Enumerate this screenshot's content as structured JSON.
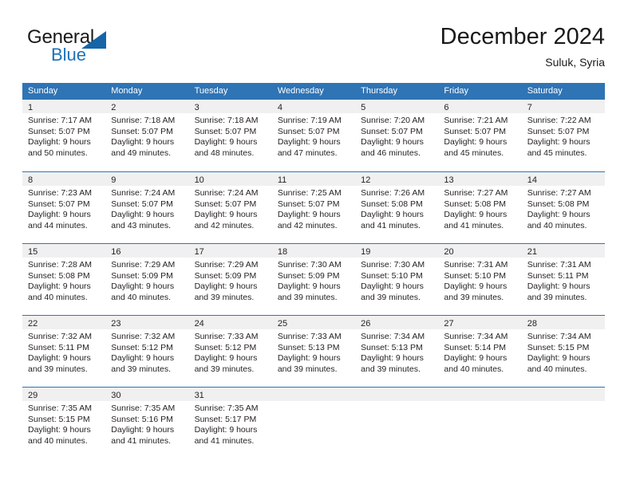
{
  "brand": {
    "name_top": "General",
    "name_bottom": "Blue",
    "accent_color": "#1d71b8",
    "triangle_color": "#1565a8"
  },
  "header": {
    "title": "December 2024",
    "subtitle": "Suluk, Syria"
  },
  "theme": {
    "header_blue": "#2f74b5",
    "day_band_gray": "#f0f0f0",
    "text_color": "#231f20"
  },
  "weekdays": [
    "Sunday",
    "Monday",
    "Tuesday",
    "Wednesday",
    "Thursday",
    "Friday",
    "Saturday"
  ],
  "weeks": [
    [
      {
        "day": "1",
        "lines": [
          "Sunrise: 7:17 AM",
          "Sunset: 5:07 PM",
          "Daylight: 9 hours",
          "and 50 minutes."
        ]
      },
      {
        "day": "2",
        "lines": [
          "Sunrise: 7:18 AM",
          "Sunset: 5:07 PM",
          "Daylight: 9 hours",
          "and 49 minutes."
        ]
      },
      {
        "day": "3",
        "lines": [
          "Sunrise: 7:18 AM",
          "Sunset: 5:07 PM",
          "Daylight: 9 hours",
          "and 48 minutes."
        ]
      },
      {
        "day": "4",
        "lines": [
          "Sunrise: 7:19 AM",
          "Sunset: 5:07 PM",
          "Daylight: 9 hours",
          "and 47 minutes."
        ]
      },
      {
        "day": "5",
        "lines": [
          "Sunrise: 7:20 AM",
          "Sunset: 5:07 PM",
          "Daylight: 9 hours",
          "and 46 minutes."
        ]
      },
      {
        "day": "6",
        "lines": [
          "Sunrise: 7:21 AM",
          "Sunset: 5:07 PM",
          "Daylight: 9 hours",
          "and 45 minutes."
        ]
      },
      {
        "day": "7",
        "lines": [
          "Sunrise: 7:22 AM",
          "Sunset: 5:07 PM",
          "Daylight: 9 hours",
          "and 45 minutes."
        ]
      }
    ],
    [
      {
        "day": "8",
        "lines": [
          "Sunrise: 7:23 AM",
          "Sunset: 5:07 PM",
          "Daylight: 9 hours",
          "and 44 minutes."
        ]
      },
      {
        "day": "9",
        "lines": [
          "Sunrise: 7:24 AM",
          "Sunset: 5:07 PM",
          "Daylight: 9 hours",
          "and 43 minutes."
        ]
      },
      {
        "day": "10",
        "lines": [
          "Sunrise: 7:24 AM",
          "Sunset: 5:07 PM",
          "Daylight: 9 hours",
          "and 42 minutes."
        ]
      },
      {
        "day": "11",
        "lines": [
          "Sunrise: 7:25 AM",
          "Sunset: 5:07 PM",
          "Daylight: 9 hours",
          "and 42 minutes."
        ]
      },
      {
        "day": "12",
        "lines": [
          "Sunrise: 7:26 AM",
          "Sunset: 5:08 PM",
          "Daylight: 9 hours",
          "and 41 minutes."
        ]
      },
      {
        "day": "13",
        "lines": [
          "Sunrise: 7:27 AM",
          "Sunset: 5:08 PM",
          "Daylight: 9 hours",
          "and 41 minutes."
        ]
      },
      {
        "day": "14",
        "lines": [
          "Sunrise: 7:27 AM",
          "Sunset: 5:08 PM",
          "Daylight: 9 hours",
          "and 40 minutes."
        ]
      }
    ],
    [
      {
        "day": "15",
        "lines": [
          "Sunrise: 7:28 AM",
          "Sunset: 5:08 PM",
          "Daylight: 9 hours",
          "and 40 minutes."
        ]
      },
      {
        "day": "16",
        "lines": [
          "Sunrise: 7:29 AM",
          "Sunset: 5:09 PM",
          "Daylight: 9 hours",
          "and 40 minutes."
        ]
      },
      {
        "day": "17",
        "lines": [
          "Sunrise: 7:29 AM",
          "Sunset: 5:09 PM",
          "Daylight: 9 hours",
          "and 39 minutes."
        ]
      },
      {
        "day": "18",
        "lines": [
          "Sunrise: 7:30 AM",
          "Sunset: 5:09 PM",
          "Daylight: 9 hours",
          "and 39 minutes."
        ]
      },
      {
        "day": "19",
        "lines": [
          "Sunrise: 7:30 AM",
          "Sunset: 5:10 PM",
          "Daylight: 9 hours",
          "and 39 minutes."
        ]
      },
      {
        "day": "20",
        "lines": [
          "Sunrise: 7:31 AM",
          "Sunset: 5:10 PM",
          "Daylight: 9 hours",
          "and 39 minutes."
        ]
      },
      {
        "day": "21",
        "lines": [
          "Sunrise: 7:31 AM",
          "Sunset: 5:11 PM",
          "Daylight: 9 hours",
          "and 39 minutes."
        ]
      }
    ],
    [
      {
        "day": "22",
        "lines": [
          "Sunrise: 7:32 AM",
          "Sunset: 5:11 PM",
          "Daylight: 9 hours",
          "and 39 minutes."
        ]
      },
      {
        "day": "23",
        "lines": [
          "Sunrise: 7:32 AM",
          "Sunset: 5:12 PM",
          "Daylight: 9 hours",
          "and 39 minutes."
        ]
      },
      {
        "day": "24",
        "lines": [
          "Sunrise: 7:33 AM",
          "Sunset: 5:12 PM",
          "Daylight: 9 hours",
          "and 39 minutes."
        ]
      },
      {
        "day": "25",
        "lines": [
          "Sunrise: 7:33 AM",
          "Sunset: 5:13 PM",
          "Daylight: 9 hours",
          "and 39 minutes."
        ]
      },
      {
        "day": "26",
        "lines": [
          "Sunrise: 7:34 AM",
          "Sunset: 5:13 PM",
          "Daylight: 9 hours",
          "and 39 minutes."
        ]
      },
      {
        "day": "27",
        "lines": [
          "Sunrise: 7:34 AM",
          "Sunset: 5:14 PM",
          "Daylight: 9 hours",
          "and 40 minutes."
        ]
      },
      {
        "day": "28",
        "lines": [
          "Sunrise: 7:34 AM",
          "Sunset: 5:15 PM",
          "Daylight: 9 hours",
          "and 40 minutes."
        ]
      }
    ],
    [
      {
        "day": "29",
        "lines": [
          "Sunrise: 7:35 AM",
          "Sunset: 5:15 PM",
          "Daylight: 9 hours",
          "and 40 minutes."
        ]
      },
      {
        "day": "30",
        "lines": [
          "Sunrise: 7:35 AM",
          "Sunset: 5:16 PM",
          "Daylight: 9 hours",
          "and 41 minutes."
        ]
      },
      {
        "day": "31",
        "lines": [
          "Sunrise: 7:35 AM",
          "Sunset: 5:17 PM",
          "Daylight: 9 hours",
          "and 41 minutes."
        ]
      },
      {
        "day": "",
        "lines": []
      },
      {
        "day": "",
        "lines": []
      },
      {
        "day": "",
        "lines": []
      },
      {
        "day": "",
        "lines": []
      }
    ]
  ]
}
